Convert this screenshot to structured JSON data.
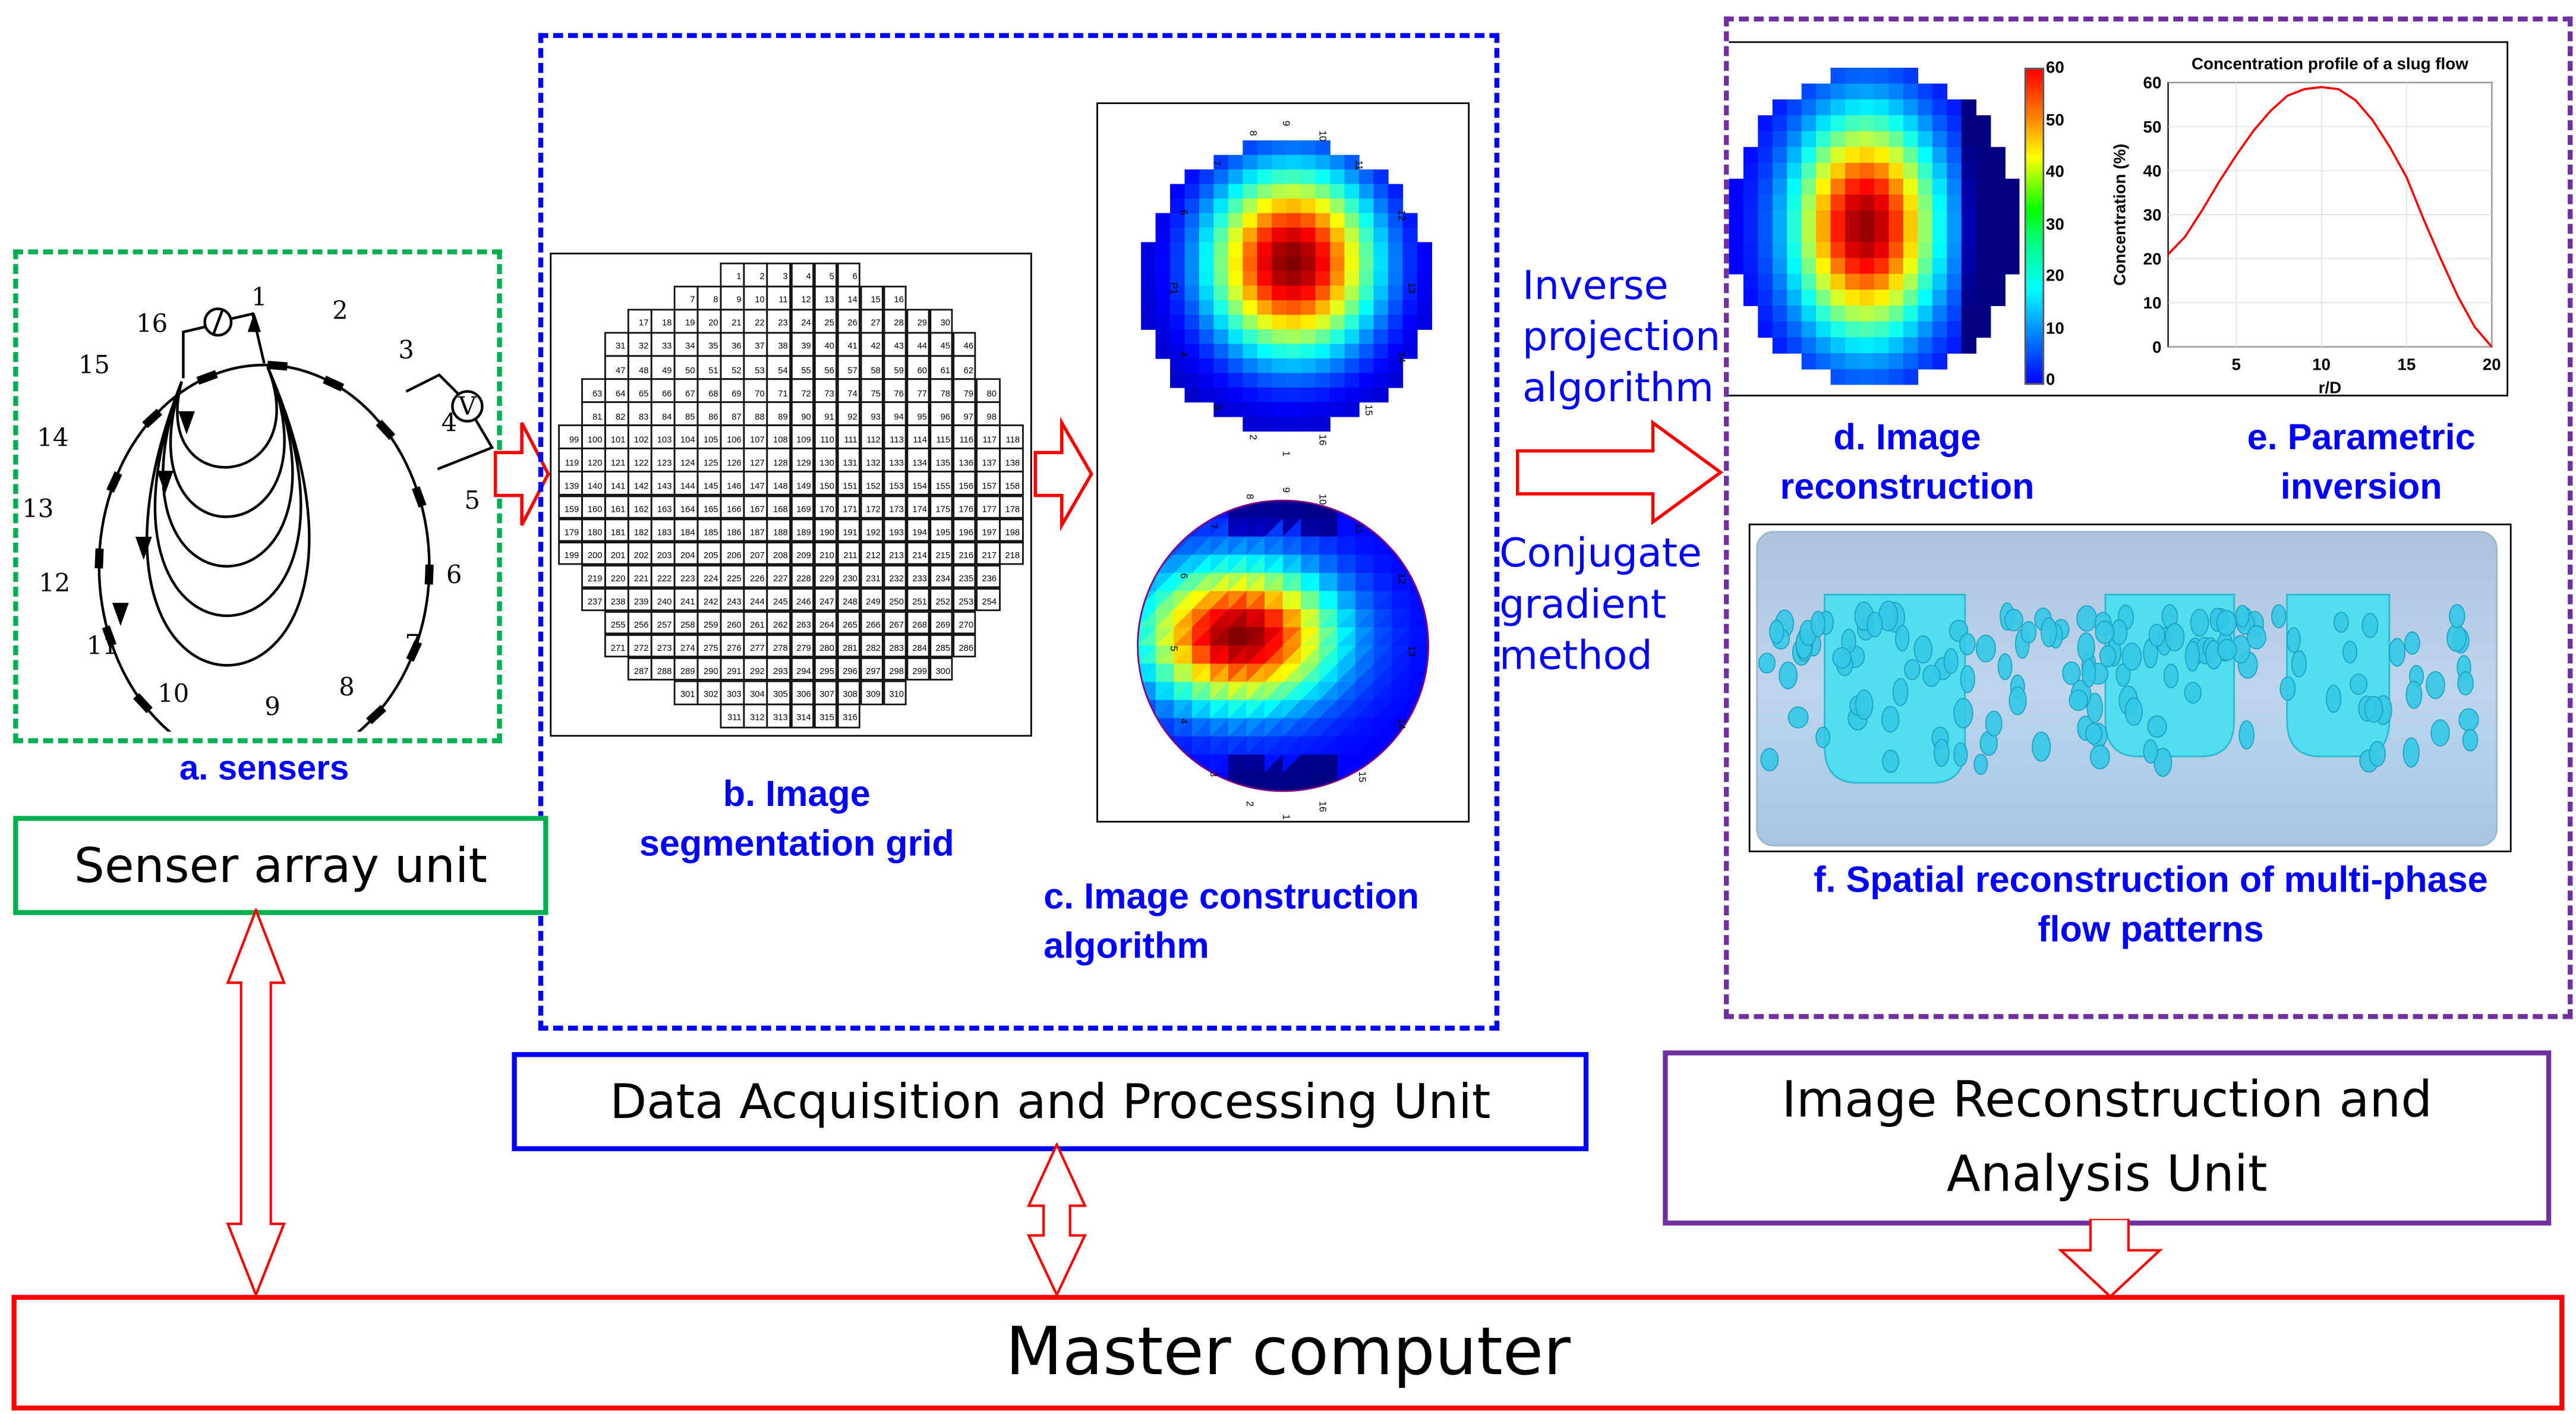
{
  "panels": {
    "a": {
      "caption": "a. sensers",
      "electrodes": [
        "1",
        "2",
        "3",
        "4",
        "5",
        "6",
        "7",
        "8",
        "9",
        "10",
        "11",
        "12",
        "13",
        "14",
        "15",
        "16"
      ],
      "current_source_symbol": "I",
      "voltmeter_symbol": "V"
    },
    "b": {
      "caption_line1": "b. Image",
      "caption_line2": "segmentation grid",
      "row_counts": [
        6,
        10,
        14,
        16,
        16,
        18,
        18,
        20,
        20,
        20,
        20,
        20,
        20,
        18,
        18,
        16,
        16,
        14,
        10,
        6
      ],
      "total_cells": 316
    },
    "c": {
      "caption_line1": "c. Image construction",
      "caption_line2": "algorithm",
      "top_map_labels": [
        "9",
        "8",
        "10",
        "7",
        "11",
        "6",
        "12",
        "P1",
        "13",
        "4",
        "14",
        "3",
        "15",
        "2",
        "16",
        "1"
      ],
      "bottom_map_labels": [
        "9",
        "8",
        "10",
        "7",
        "11",
        "6",
        "12",
        "5",
        "13",
        "4",
        "14",
        "3",
        "15",
        "2",
        "16",
        "1"
      ]
    },
    "d": {
      "caption_line1": "d. Image",
      "caption_line2": "reconstruction",
      "colorbar_ticks": [
        "60",
        "50",
        "40",
        "30",
        "20",
        "10",
        "0"
      ]
    },
    "e": {
      "caption_line1": "e. Parametric",
      "caption_line2": "inversion"
    },
    "f": {
      "caption_line1": "f. Spatial reconstruction of multi-phase",
      "caption_line2": "flow patterns"
    }
  },
  "middle": {
    "inverse_line1": "Inverse",
    "inverse_line2": "projection",
    "inverse_line3": "algorithm",
    "cg_line1": "Conjugate",
    "cg_line2": "gradient",
    "cg_line3": "method"
  },
  "units": {
    "senser": "Senser array unit",
    "daq": "Data Acquisition and Processing Unit",
    "recon_line1": "Image Reconstruction and",
    "recon_line2": "Analysis Unit",
    "master": "Master computer"
  },
  "colors": {
    "green": "#00b050",
    "blue": "#0000ff",
    "purple": "#7030a0",
    "red": "#ff0000"
  },
  "chart_data": {
    "type": "line",
    "title": "Concentration profile of a slug flow",
    "xlabel": "r/D",
    "ylabel": "Concentration (%)",
    "xlim": [
      1,
      20
    ],
    "ylim": [
      0,
      60
    ],
    "xticks": [
      5,
      10,
      15,
      20
    ],
    "yticks": [
      0,
      10,
      20,
      30,
      40,
      50,
      60
    ],
    "grid": true,
    "series": [
      {
        "name": "concentration",
        "color": "#ff0000",
        "x": [
          1,
          2,
          3,
          4,
          5,
          6,
          7,
          8,
          9,
          10,
          11,
          12,
          13,
          14,
          15,
          16,
          17,
          18,
          19,
          20
        ],
        "y": [
          21,
          25,
          31,
          37.5,
          43.5,
          49,
          53.5,
          57,
          58.5,
          59,
          58.5,
          56,
          51.5,
          45.5,
          38.5,
          29,
          20,
          11.5,
          4.5,
          0
        ]
      }
    ]
  }
}
